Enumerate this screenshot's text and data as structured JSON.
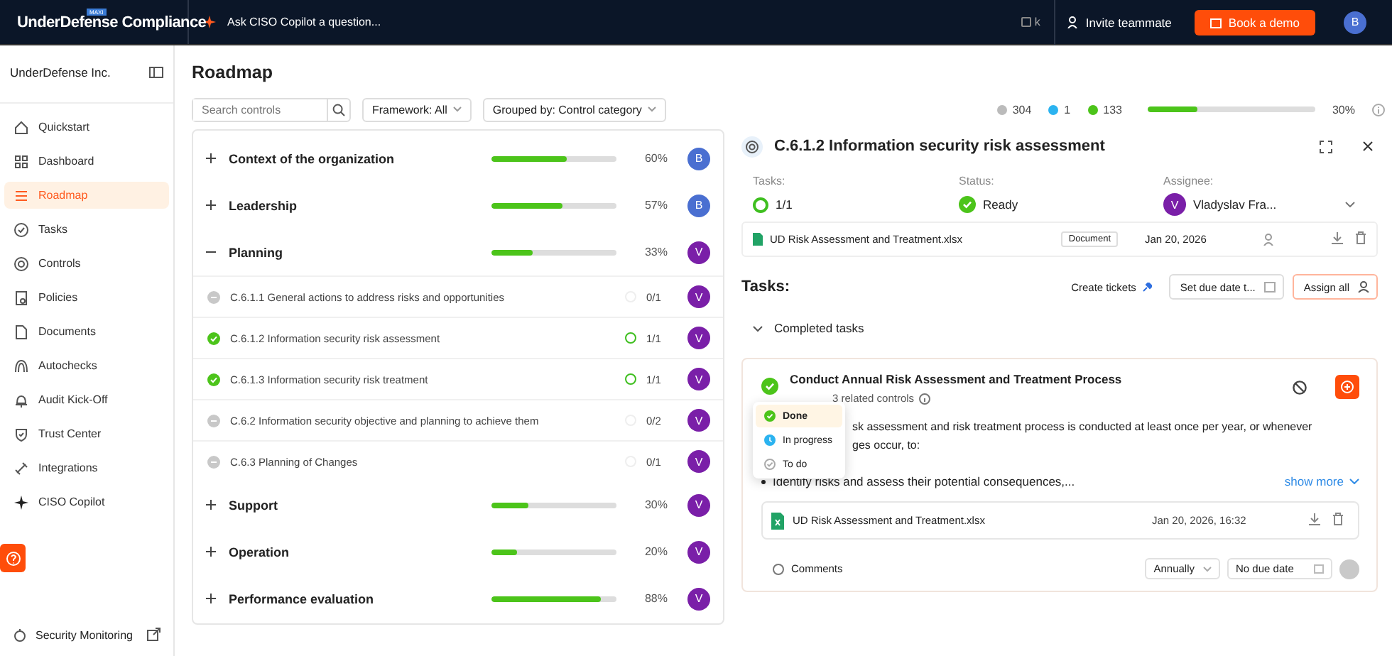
{
  "topbar": {
    "logo": "UnderDefense Compliance",
    "logo_badge": "MAXI",
    "copilot_prompt": "Ask CISO Copilot a question...",
    "shortcut": "k",
    "invite": "Invite teammate",
    "demo": "Book a demo",
    "avatar": "B"
  },
  "sidebar": {
    "org": "UnderDefense Inc.",
    "items": [
      {
        "label": "Quickstart",
        "selected": false
      },
      {
        "label": "Dashboard",
        "selected": false
      },
      {
        "label": "Roadmap",
        "selected": true
      },
      {
        "label": "Tasks",
        "selected": false
      },
      {
        "label": "Controls",
        "selected": false
      },
      {
        "label": "Policies",
        "selected": false
      },
      {
        "label": "Documents",
        "selected": false
      },
      {
        "label": "Autochecks",
        "selected": false
      },
      {
        "label": "Audit Kick-Off",
        "selected": false
      },
      {
        "label": "Trust Center",
        "selected": false
      },
      {
        "label": "Integrations",
        "selected": false
      },
      {
        "label": "CISO Copilot",
        "selected": false
      }
    ],
    "footer": "Security Monitoring"
  },
  "main": {
    "title": "Roadmap",
    "search": {
      "placeholder": "Search controls"
    },
    "filters": [
      "Framework: All",
      "Grouped by: Control category"
    ],
    "stats": [
      {
        "kind": "todo",
        "value": "304"
      },
      {
        "kind": "progress",
        "value": "1"
      },
      {
        "kind": "done",
        "value": "133"
      }
    ],
    "overall": {
      "level": 0.3,
      "reading": "30%"
    }
  },
  "categories": [
    {
      "label": "Context of the organization",
      "expanded": false,
      "level": 0.6,
      "reading": "60%",
      "avatar": "B",
      "color": "#4a6fd1"
    },
    {
      "label": "Leadership",
      "expanded": false,
      "level": 0.57,
      "reading": "57%",
      "avatar": "B",
      "color": "#4a6fd1"
    },
    {
      "label": "Planning",
      "expanded": true,
      "level": 0.33,
      "reading": "33%",
      "avatar": "V",
      "color": "#7a1fa8",
      "children": [
        {
          "label": "C.6.1.1 General actions to address risks and opportunities",
          "kind": "todo",
          "count": "0/1",
          "avatar": "V",
          "color": "#7a1fa8"
        },
        {
          "label": "C.6.1.2 Information security risk assessment",
          "kind": "done",
          "count": "1/1",
          "avatar": "V",
          "color": "#7a1fa8"
        },
        {
          "label": "C.6.1.3 Information security risk treatment",
          "kind": "done",
          "count": "1/1",
          "avatar": "V",
          "color": "#7a1fa8"
        },
        {
          "label": "C.6.2 Information security objective and planning to achieve them",
          "kind": "todo",
          "count": "0/2",
          "avatar": "V",
          "color": "#7a1fa8"
        },
        {
          "label": "C.6.3 Planning of Changes",
          "kind": "todo",
          "count": "0/1",
          "avatar": "V",
          "color": "#7a1fa8"
        }
      ]
    },
    {
      "label": "Support",
      "expanded": false,
      "level": 0.3,
      "reading": "30%",
      "avatar": "V",
      "color": "#7a1fa8"
    },
    {
      "label": "Operation",
      "expanded": false,
      "level": 0.2,
      "reading": "20%",
      "avatar": "V",
      "color": "#7a1fa8"
    },
    {
      "label": "Performance evaluation",
      "expanded": false,
      "level": 0.88,
      "reading": "88%",
      "avatar": "V",
      "color": "#7a1fa8"
    }
  ],
  "detail": {
    "title": "C.6.1.2 Information security risk assessment",
    "tasks_label": "Tasks:",
    "tasks_value": "1/1",
    "status_label": "Status:",
    "status": "Ready",
    "assignee_label": "Assignee:",
    "assignee": "Vladyslav Fra...",
    "assignee_avatar": "V",
    "file": {
      "name": "UD Risk Assessment and Treatment.xlsx",
      "tag": "Document",
      "date": "Jan 20, 2026"
    },
    "tasks_heading": "Tasks:",
    "create_tickets": "Create tickets",
    "due_button": "Set due date t...",
    "assign_all": "Assign all",
    "group": {
      "label": "Completed tasks",
      "expanded": true
    },
    "task": {
      "title": "Conduct Annual Risk Assessment and Treatment Process",
      "done": true,
      "related": "3 related controls",
      "description": [
        "sk assessment and risk treatment process is conducted at least once per year, or whenever",
        "ges occur, to:"
      ],
      "bullet": "Identify risks and assess their potential consequences,...",
      "show_more": "show more",
      "file": {
        "name": "UD Risk Assessment and Treatment.xlsx",
        "date": "Jan 20, 2026, 16:32"
      },
      "comments": "Comments",
      "frequency": "Annually",
      "due": "No due date"
    },
    "status_menu": [
      {
        "label": "Done",
        "kind": "done",
        "selected": true
      },
      {
        "label": "In progress",
        "kind": "progress",
        "selected": false
      },
      {
        "label": "To do",
        "kind": "todo",
        "selected": false
      }
    ]
  }
}
